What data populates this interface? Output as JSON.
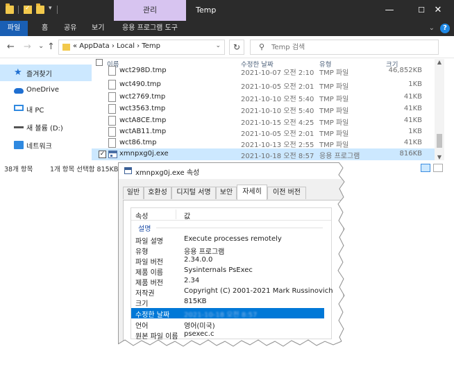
{
  "window": {
    "manage_tab": "관리",
    "title": "Temp",
    "minimize": "—",
    "maximize": "☐",
    "close": "✕"
  },
  "ribbon": {
    "tabs": [
      "파일",
      "홈",
      "공유",
      "보기",
      "응용 프로그램 도구"
    ],
    "collapse": "⌄",
    "help": "?"
  },
  "nav": {
    "back": "←",
    "forward": "→",
    "recent": "⌄",
    "up": "↑",
    "breadcrumb": "« AppData › Local › Temp",
    "address_dropdown": "⌄",
    "refresh": "↻",
    "search_placeholder": "Temp 검색"
  },
  "sidebar": {
    "items": [
      {
        "label": "즐겨찾기",
        "icon": "star-icon"
      },
      {
        "label": "OneDrive",
        "icon": "cloud-icon"
      },
      {
        "label": "내 PC",
        "icon": "pc-icon"
      },
      {
        "label": "새 볼륨 (D:)",
        "icon": "drive-icon"
      },
      {
        "label": "네트워크",
        "icon": "network-icon"
      }
    ]
  },
  "columns": {
    "name": "이름",
    "date": "수정한 날짜",
    "type": "유형",
    "size": "크기"
  },
  "files": [
    {
      "name": "wct298D.tmp",
      "date": "2021-10-07 오전 2:10",
      "type": "TMP 파일",
      "size": "46,852KB"
    },
    {
      "name": "wct490.tmp",
      "date": "2021-10-05 오전 2:01",
      "type": "TMP 파일",
      "size": "1KB"
    },
    {
      "name": "wct2769.tmp",
      "date": "2021-10-10 오전 5:40",
      "type": "TMP 파일",
      "size": "41KB"
    },
    {
      "name": "wct3563.tmp",
      "date": "2021-10-10 오전 5:40",
      "type": "TMP 파일",
      "size": "41KB"
    },
    {
      "name": "wctA8CE.tmp",
      "date": "2021-10-15 오전 4:25",
      "type": "TMP 파일",
      "size": "41KB"
    },
    {
      "name": "wctAB11.tmp",
      "date": "2021-10-05 오전 2:01",
      "type": "TMP 파일",
      "size": "1KB"
    },
    {
      "name": "wct86.tmp",
      "date": "2021-10-13 오전 2:55",
      "type": "TMP 파일",
      "size": "41KB"
    },
    {
      "name": "xmnpxg0j.exe",
      "date": "2021-10-18 오전 8:57",
      "type": "응용 프로그램",
      "size": "816KB",
      "selected": true,
      "check": "✓"
    }
  ],
  "status": {
    "count": "38개 항목",
    "selection": "1개 항목 선택함 815KB"
  },
  "dialog": {
    "title": "xmnpxg0j.exe 속성",
    "tabs": [
      "일반",
      "호환성",
      "디지털 서명",
      "보안",
      "자세히",
      "이전 버전"
    ],
    "active_tab": "자세히",
    "header_property": "속성",
    "header_value": "값",
    "section": "설명",
    "rows": [
      {
        "key": "파일 설명",
        "value": "Execute processes remotely"
      },
      {
        "key": "유형",
        "value": "응용 프로그램"
      },
      {
        "key": "파일 버전",
        "value": "2.34.0.0"
      },
      {
        "key": "제품 이름",
        "value": "Sysinternals PsExec"
      },
      {
        "key": "제품 버전",
        "value": "2.34"
      },
      {
        "key": "저작권",
        "value": "Copyright (C) 2001-2021 Mark Russinovich"
      },
      {
        "key": "크기",
        "value": "815KB"
      },
      {
        "key": "수정한 날짜",
        "value": "2021-10-18 오전 8:57",
        "highlighted": true
      },
      {
        "key": "언어",
        "value": "영어(미국)"
      },
      {
        "key": "원본 파일 이름",
        "value": "psexec.c"
      }
    ]
  },
  "colors": {
    "titlebar": "#2b2b2b",
    "manage_tab": "#d7c4f0",
    "file_tab": "#1a5fb4",
    "selection": "#cce8ff",
    "highlight_row": "#0078d7"
  }
}
